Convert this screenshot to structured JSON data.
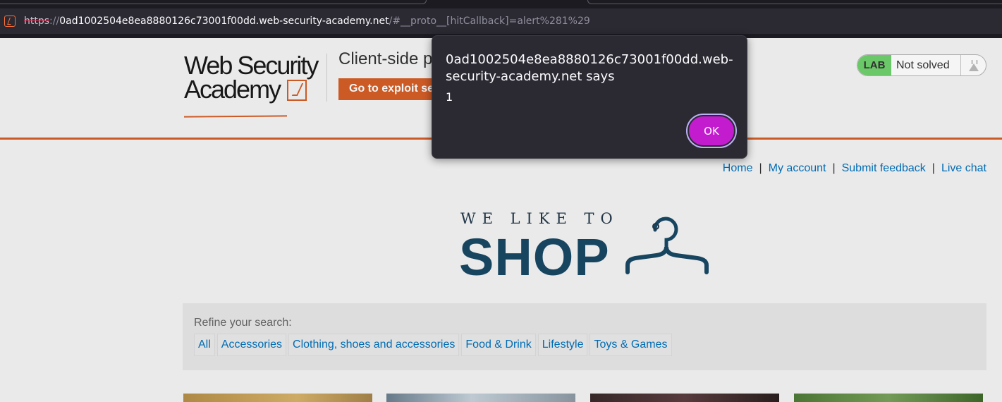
{
  "browser": {
    "url_scheme": "https",
    "url_sep": "://",
    "url_host": "0ad1002504e8ea8880126c73001f00dd.web-security-academy.net",
    "url_path": "/#__proto__[hitCallback]=alert%281%29"
  },
  "header": {
    "logo_line1": "Web Security",
    "logo_line2": "Academy",
    "lab_title": "Client-side p",
    "exploit_button": "Go to exploit se",
    "status_badge": "LAB",
    "status_text": "Not solved"
  },
  "nav": {
    "items": [
      "Home",
      "My account",
      "Submit feedback",
      "Live chat"
    ],
    "separator": "|"
  },
  "shop_logo": {
    "tagline": "WE LIKE TO",
    "word": "SHOP"
  },
  "filter": {
    "label": "Refine your search:",
    "categories": [
      "All",
      "Accessories",
      "Clothing, shoes and accessories",
      "Food & Drink",
      "Lifestyle",
      "Toys & Games"
    ]
  },
  "dialog": {
    "message": "0ad1002504e8ea8880126c73001f00dd.web-security-academy.net says",
    "value": "1",
    "ok_label": "OK"
  },
  "colors": {
    "accent_orange": "#d55e27",
    "link_blue": "#0071bc",
    "status_green": "#70d16d",
    "dialog_ok": "#c31ccf",
    "shop_blue": "#184864"
  }
}
